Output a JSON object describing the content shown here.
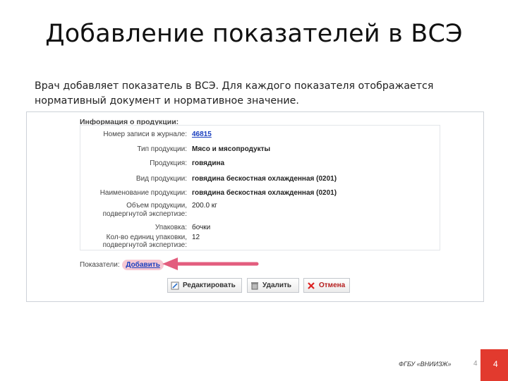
{
  "slide": {
    "title": "Добавление показателей в ВСЭ",
    "description": "Врач добавляет показатель в ВСЭ. Для каждого показателя отображается нормативный документ и нормативное значение."
  },
  "form": {
    "section_title": "Информация о продукции:",
    "rows": [
      {
        "label": "Номер записи в журнале:",
        "value": "46815"
      },
      {
        "label": "Тип продукции:",
        "value": "Мясо и мясопродукты"
      },
      {
        "label": "Продукция:",
        "value": "говядина"
      },
      {
        "label": "Вид продукции:",
        "value": "говядина бескостная охлажденная (0201)"
      },
      {
        "label": "Наименование продукции:",
        "value": "говядина бескостная охлажденная (0201)"
      },
      {
        "label": "Объем продукции, подвергнутой экспертизе:",
        "value": "200.0 кг"
      },
      {
        "label": "Упаковка:",
        "value": "бочки"
      },
      {
        "label": "Кол-во единиц упаковки, подвергнутой экспертизе:",
        "value": "12"
      }
    ],
    "indicators_label": "Показатели:",
    "add_link": "Добавить"
  },
  "buttons": {
    "edit": "Редактировать",
    "delete": "Удалить",
    "cancel": "Отмена"
  },
  "footer": {
    "organization": "ФГБУ «ВНИИЗЖ»",
    "page_number_gray": "4",
    "page_number": "4"
  },
  "colors": {
    "accent_red": "#e23a2e",
    "link_blue": "#1a3fbf",
    "highlight_pink": "#f6c8d3"
  }
}
